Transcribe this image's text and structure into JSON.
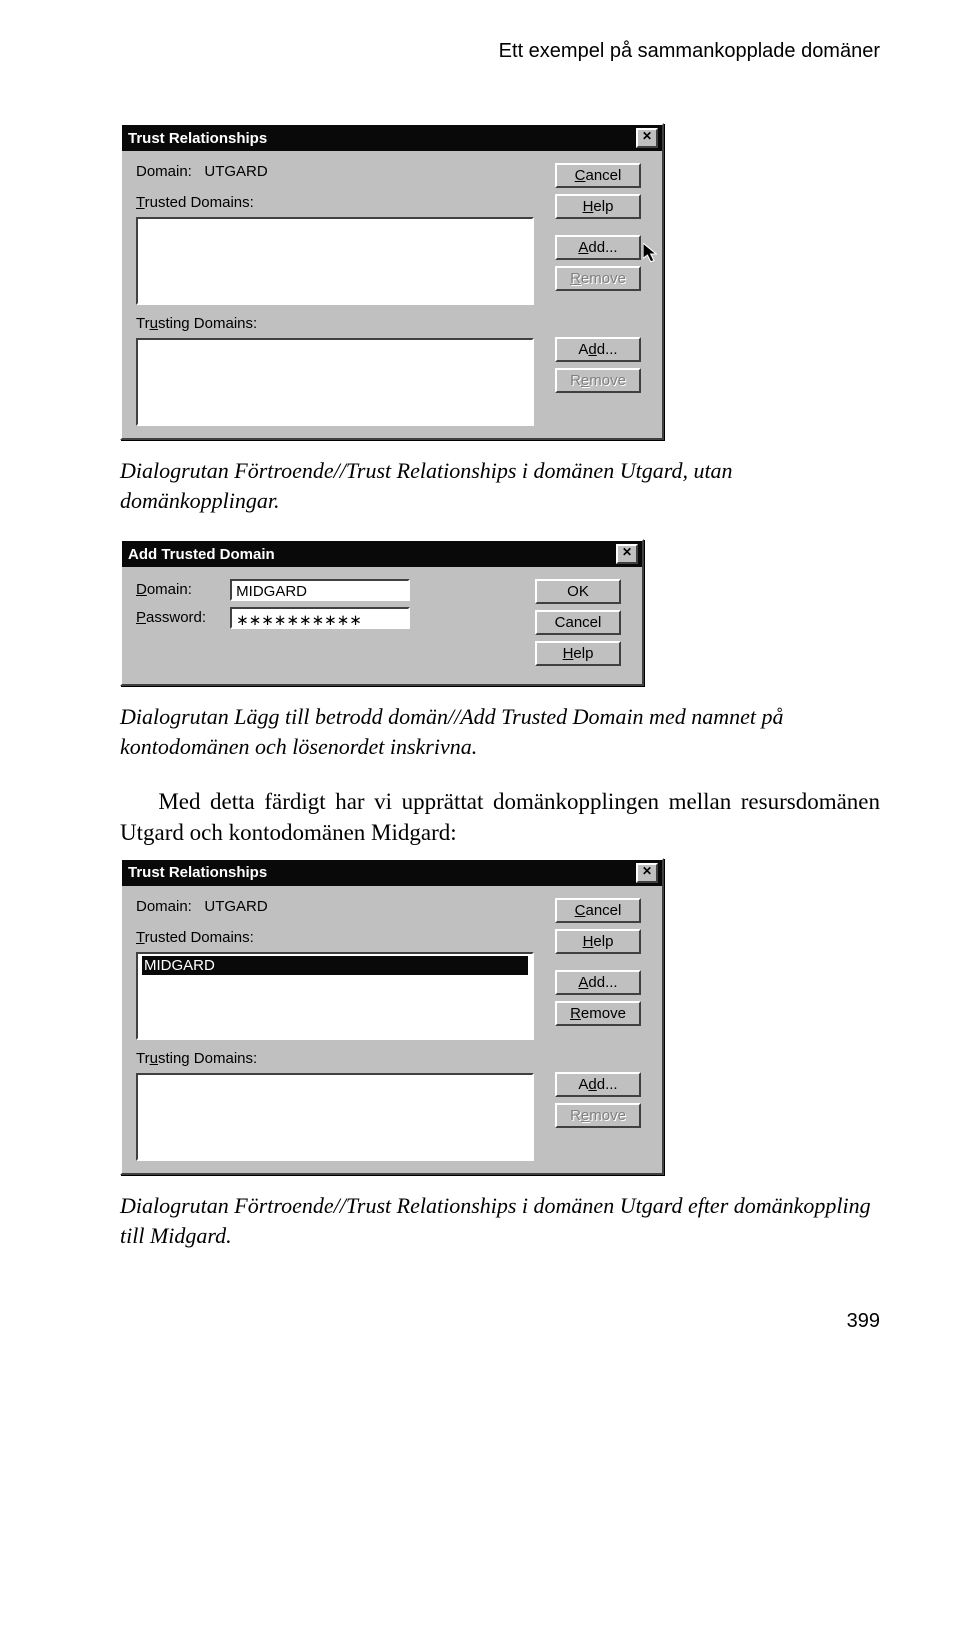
{
  "header": {
    "title": "Ett exempel på sammankopplade domäner"
  },
  "dlg1": {
    "title": "Trust Relationships",
    "domain_label": "Domain:",
    "domain_value": "UTGARD",
    "trusted_label": "Trusted Domains:",
    "trusting_label": "Trusting Domains:",
    "btn_cancel": "Cancel",
    "btn_help": "Help",
    "btn_add": "Add...",
    "btn_remove": "Remove"
  },
  "caption1": "Dialogrutan Förtroende//Trust Relationships i domänen Utgard, utan domänkopplingar.",
  "dlg2": {
    "title": "Add Trusted Domain",
    "domain_label": "Domain:",
    "domain_value": "MIDGARD",
    "password_label": "Password:",
    "password_value": "∗∗∗∗∗∗∗∗∗∗",
    "btn_ok": "OK",
    "btn_cancel": "Cancel",
    "btn_help": "Help"
  },
  "caption2": "Dialogrutan Lägg till betrodd domän//Add Trusted Domain med namnet på kontodomänen och lösenordet inskrivna.",
  "body": "Med detta färdigt har vi upprättat domänkopplingen mellan resursdomänen Utgard och kontodomänen Midgard:",
  "dlg3": {
    "title": "Trust Relationships",
    "domain_label": "Domain:",
    "domain_value": "UTGARD",
    "trusted_label": "Trusted Domains:",
    "trusted_item": "MIDGARD",
    "trusting_label": "Trusting Domains:",
    "btn_cancel": "Cancel",
    "btn_help": "Help",
    "btn_add": "Add...",
    "btn_remove": "Remove"
  },
  "caption3": "Dialogrutan Förtroende//Trust Relationships i domänen Utgard efter domänkoppling till Midgard.",
  "page_number": "399"
}
